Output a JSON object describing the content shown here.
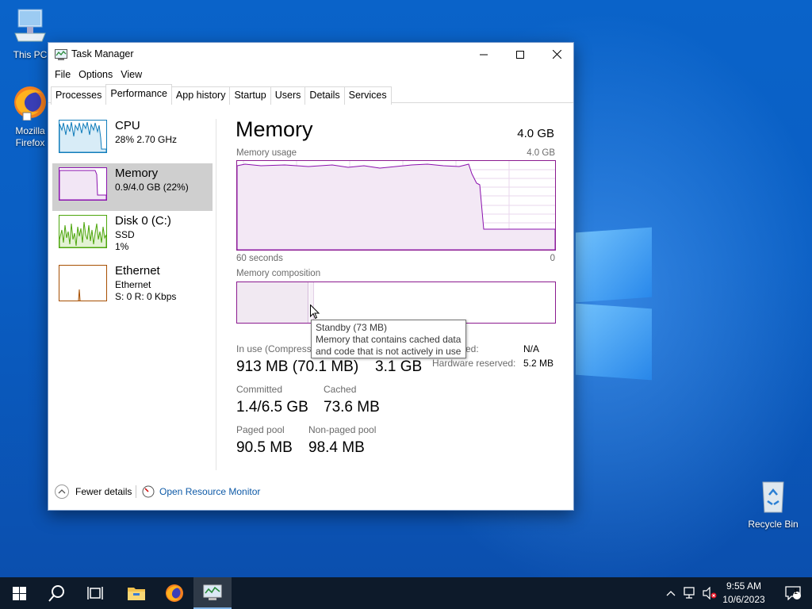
{
  "desktop": {
    "icons": [
      {
        "label": "This PC"
      },
      {
        "label": "Mozilla Firefox"
      },
      {
        "label": "Recycle Bin"
      }
    ]
  },
  "window": {
    "title": "Task Manager",
    "menu": [
      "File",
      "Options",
      "View"
    ],
    "tabs": [
      "Processes",
      "Performance",
      "App history",
      "Startup",
      "Users",
      "Details",
      "Services"
    ],
    "active_tab": "Performance"
  },
  "sidebar": {
    "items": [
      {
        "name": "CPU",
        "sub1": "28% 2.70 GHz",
        "sub2": "",
        "color": "#117dbb"
      },
      {
        "name": "Memory",
        "sub1": "0.9/4.0 GB (22%)",
        "sub2": "",
        "color": "#8b12ae",
        "selected": true
      },
      {
        "name": "Disk 0 (C:)",
        "sub1": "SSD",
        "sub2": "1%",
        "color": "#4da60c"
      },
      {
        "name": "Ethernet",
        "sub1": "Ethernet",
        "sub2": "S: 0 R: 0 Kbps",
        "color": "#a74f01"
      }
    ]
  },
  "detail": {
    "title": "Memory",
    "total": "4.0 GB",
    "usage_label": "Memory usage",
    "usage_max": "4.0 GB",
    "axis_left": "60 seconds",
    "axis_right": "0",
    "composition_label": "Memory composition",
    "tooltip": {
      "line1": "Standby (73 MB)",
      "line2": "Memory that contains cached data",
      "line3": "and code that is not actively in use"
    },
    "stats": {
      "in_use_label": "In use (Compress",
      "in_use_value": "913 MB (70.1 MB)",
      "available_value": "3.1 GB",
      "committed_label": "Committed",
      "committed_value": "1.4/6.5 GB",
      "cached_label": "Cached",
      "cached_value": "73.6 MB",
      "paged_label": "Paged pool",
      "paged_value": "90.5 MB",
      "nonpaged_label": "Non-paged pool",
      "nonpaged_value": "98.4 MB"
    },
    "side": {
      "slots_label_partial": "ed:",
      "slots_value": "N/A",
      "hw_label": "Hardware reserved:",
      "hw_value": "5.2 MB"
    }
  },
  "footer": {
    "fewer_details": "Fewer details",
    "open_monitor": "Open Resource Monitor"
  },
  "taskbar": {
    "time": "9:55 AM",
    "date": "10/6/2023",
    "notification_count": "1"
  }
}
